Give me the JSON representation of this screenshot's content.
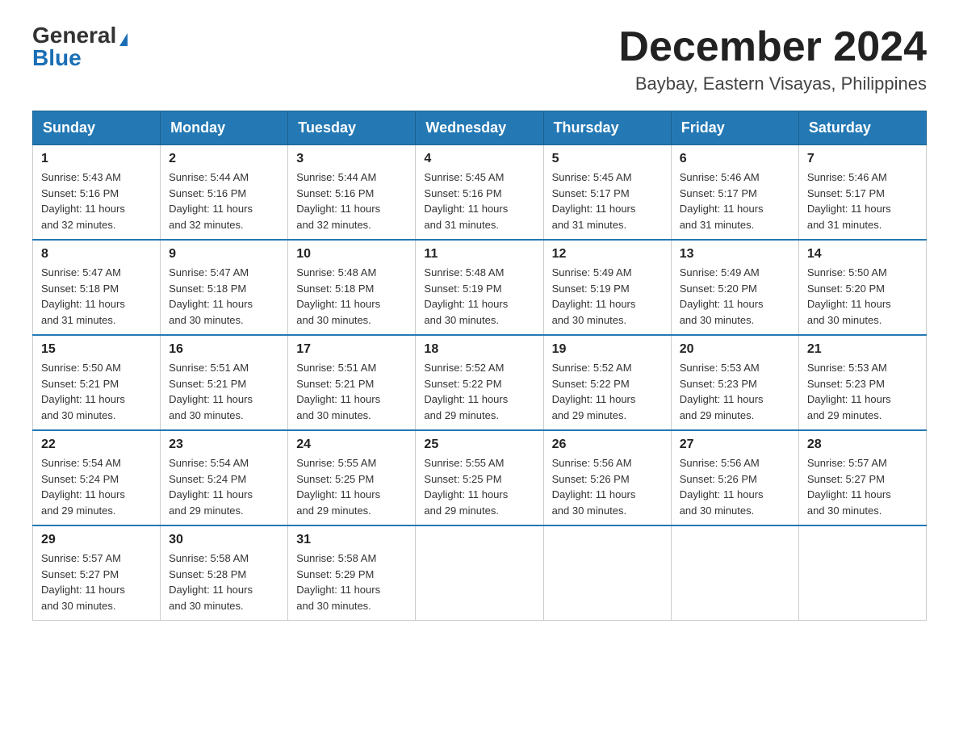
{
  "header": {
    "logo_general": "General",
    "logo_blue": "Blue",
    "month_title": "December 2024",
    "location": "Baybay, Eastern Visayas, Philippines"
  },
  "weekdays": [
    "Sunday",
    "Monday",
    "Tuesday",
    "Wednesday",
    "Thursday",
    "Friday",
    "Saturday"
  ],
  "weeks": [
    [
      {
        "day": "1",
        "sunrise": "5:43 AM",
        "sunset": "5:16 PM",
        "daylight": "11 hours and 32 minutes."
      },
      {
        "day": "2",
        "sunrise": "5:44 AM",
        "sunset": "5:16 PM",
        "daylight": "11 hours and 32 minutes."
      },
      {
        "day": "3",
        "sunrise": "5:44 AM",
        "sunset": "5:16 PM",
        "daylight": "11 hours and 32 minutes."
      },
      {
        "day": "4",
        "sunrise": "5:45 AM",
        "sunset": "5:16 PM",
        "daylight": "11 hours and 31 minutes."
      },
      {
        "day": "5",
        "sunrise": "5:45 AM",
        "sunset": "5:17 PM",
        "daylight": "11 hours and 31 minutes."
      },
      {
        "day": "6",
        "sunrise": "5:46 AM",
        "sunset": "5:17 PM",
        "daylight": "11 hours and 31 minutes."
      },
      {
        "day": "7",
        "sunrise": "5:46 AM",
        "sunset": "5:17 PM",
        "daylight": "11 hours and 31 minutes."
      }
    ],
    [
      {
        "day": "8",
        "sunrise": "5:47 AM",
        "sunset": "5:18 PM",
        "daylight": "11 hours and 31 minutes."
      },
      {
        "day": "9",
        "sunrise": "5:47 AM",
        "sunset": "5:18 PM",
        "daylight": "11 hours and 30 minutes."
      },
      {
        "day": "10",
        "sunrise": "5:48 AM",
        "sunset": "5:18 PM",
        "daylight": "11 hours and 30 minutes."
      },
      {
        "day": "11",
        "sunrise": "5:48 AM",
        "sunset": "5:19 PM",
        "daylight": "11 hours and 30 minutes."
      },
      {
        "day": "12",
        "sunrise": "5:49 AM",
        "sunset": "5:19 PM",
        "daylight": "11 hours and 30 minutes."
      },
      {
        "day": "13",
        "sunrise": "5:49 AM",
        "sunset": "5:20 PM",
        "daylight": "11 hours and 30 minutes."
      },
      {
        "day": "14",
        "sunrise": "5:50 AM",
        "sunset": "5:20 PM",
        "daylight": "11 hours and 30 minutes."
      }
    ],
    [
      {
        "day": "15",
        "sunrise": "5:50 AM",
        "sunset": "5:21 PM",
        "daylight": "11 hours and 30 minutes."
      },
      {
        "day": "16",
        "sunrise": "5:51 AM",
        "sunset": "5:21 PM",
        "daylight": "11 hours and 30 minutes."
      },
      {
        "day": "17",
        "sunrise": "5:51 AM",
        "sunset": "5:21 PM",
        "daylight": "11 hours and 30 minutes."
      },
      {
        "day": "18",
        "sunrise": "5:52 AM",
        "sunset": "5:22 PM",
        "daylight": "11 hours and 29 minutes."
      },
      {
        "day": "19",
        "sunrise": "5:52 AM",
        "sunset": "5:22 PM",
        "daylight": "11 hours and 29 minutes."
      },
      {
        "day": "20",
        "sunrise": "5:53 AM",
        "sunset": "5:23 PM",
        "daylight": "11 hours and 29 minutes."
      },
      {
        "day": "21",
        "sunrise": "5:53 AM",
        "sunset": "5:23 PM",
        "daylight": "11 hours and 29 minutes."
      }
    ],
    [
      {
        "day": "22",
        "sunrise": "5:54 AM",
        "sunset": "5:24 PM",
        "daylight": "11 hours and 29 minutes."
      },
      {
        "day": "23",
        "sunrise": "5:54 AM",
        "sunset": "5:24 PM",
        "daylight": "11 hours and 29 minutes."
      },
      {
        "day": "24",
        "sunrise": "5:55 AM",
        "sunset": "5:25 PM",
        "daylight": "11 hours and 29 minutes."
      },
      {
        "day": "25",
        "sunrise": "5:55 AM",
        "sunset": "5:25 PM",
        "daylight": "11 hours and 29 minutes."
      },
      {
        "day": "26",
        "sunrise": "5:56 AM",
        "sunset": "5:26 PM",
        "daylight": "11 hours and 30 minutes."
      },
      {
        "day": "27",
        "sunrise": "5:56 AM",
        "sunset": "5:26 PM",
        "daylight": "11 hours and 30 minutes."
      },
      {
        "day": "28",
        "sunrise": "5:57 AM",
        "sunset": "5:27 PM",
        "daylight": "11 hours and 30 minutes."
      }
    ],
    [
      {
        "day": "29",
        "sunrise": "5:57 AM",
        "sunset": "5:27 PM",
        "daylight": "11 hours and 30 minutes."
      },
      {
        "day": "30",
        "sunrise": "5:58 AM",
        "sunset": "5:28 PM",
        "daylight": "11 hours and 30 minutes."
      },
      {
        "day": "31",
        "sunrise": "5:58 AM",
        "sunset": "5:29 PM",
        "daylight": "11 hours and 30 minutes."
      },
      null,
      null,
      null,
      null
    ]
  ],
  "labels": {
    "sunrise_prefix": "Sunrise: ",
    "sunset_prefix": "Sunset: ",
    "daylight_prefix": "Daylight: "
  }
}
